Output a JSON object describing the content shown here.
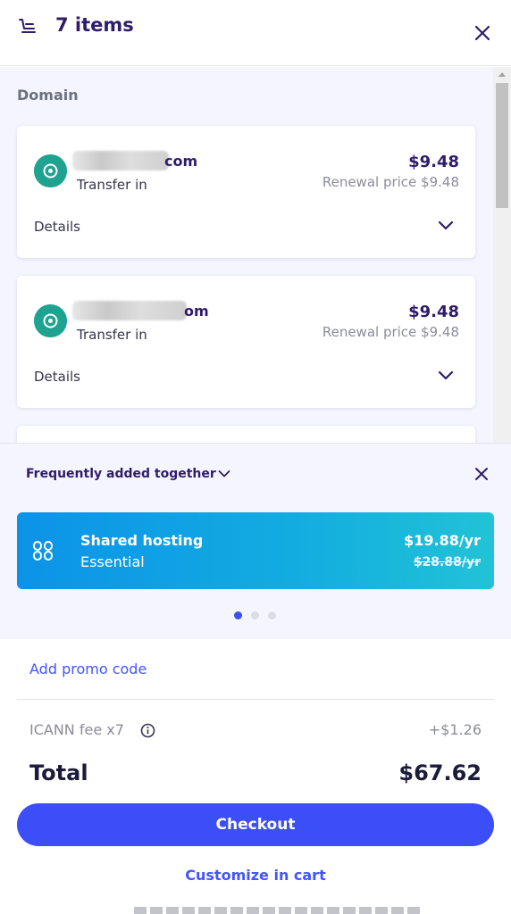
{
  "header": {
    "title": "7 items",
    "cart_icon": "cart-icon",
    "close_icon": "close-icon"
  },
  "domain_section": {
    "label": "Domain",
    "items": [
      {
        "name_suffix": "com",
        "type": "Transfer in",
        "price": "$9.48",
        "renewal": "Renewal price $9.48",
        "details_label": "Details"
      },
      {
        "name_suffix": "om",
        "type": "Transfer in",
        "price": "$9.48",
        "renewal": "Renewal price $9.48",
        "details_label": "Details"
      }
    ]
  },
  "frequently_added": {
    "title": "Frequently added together",
    "offer": {
      "name": "Shared hosting",
      "plan": "Essential",
      "price": "$19.88/yr",
      "original_price": "$28.88/yr"
    },
    "pagination": {
      "total": 3,
      "active": 1
    }
  },
  "summary": {
    "promo_link": "Add promo code",
    "fee_label": "ICANN fee x7",
    "fee_value": "+$1.26",
    "total_label": "Total",
    "total_value": "$67.62",
    "checkout_label": "Checkout",
    "customize_label": "Customize in cart"
  },
  "colors": {
    "accent": "#3b4ef8",
    "link": "#4255ff",
    "domain_icon": "#1ea390",
    "promo_gradient_start": "#0c93e8",
    "promo_gradient_end": "#21c3d6"
  }
}
